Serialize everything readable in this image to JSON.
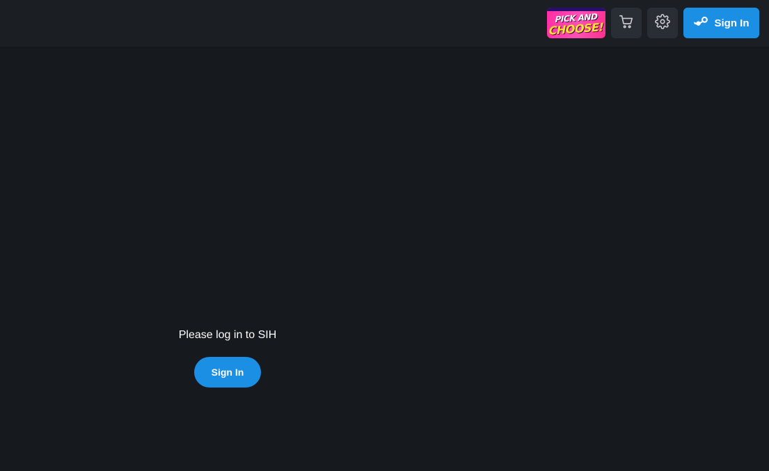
{
  "header": {
    "promo": {
      "line1": "PICK AND",
      "line2": "CHOOSE!",
      "colors": {
        "bg": "#ff2fa3",
        "line2": "#ffe32e"
      }
    },
    "cart": {
      "icon": "cart-icon"
    },
    "settings": {
      "icon": "gear-icon"
    },
    "sign_in": {
      "icon": "steam-icon",
      "label": "Sign In"
    }
  },
  "main": {
    "prompt": "Please log in to SIH",
    "sign_in_label": "Sign In"
  },
  "colors": {
    "accent": "#1a8fe3",
    "background": "#16191d",
    "topbar": "#1b1e23"
  }
}
